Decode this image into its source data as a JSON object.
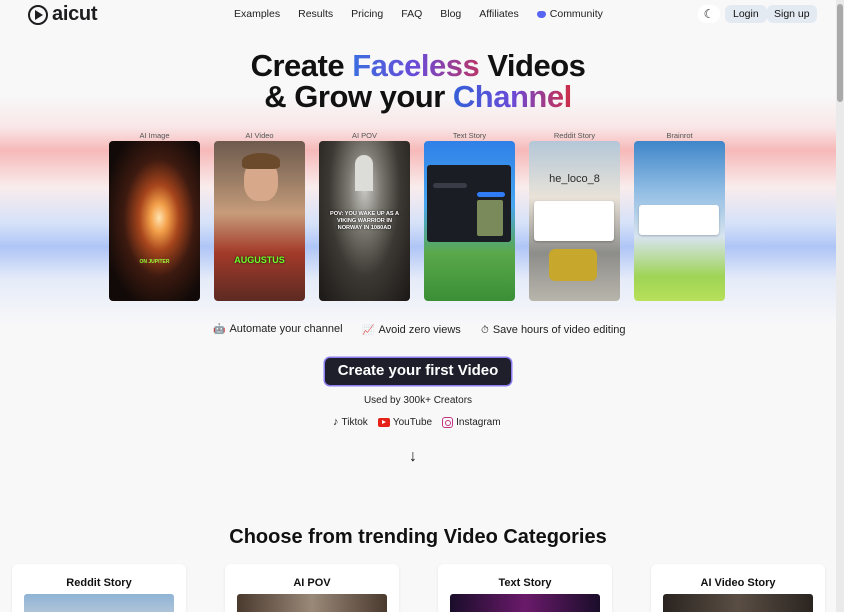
{
  "brand": {
    "name": "aicut"
  },
  "nav": {
    "links": [
      "Examples",
      "Results",
      "Pricing",
      "FAQ",
      "Blog",
      "Affiliates"
    ],
    "community": "Community",
    "login": "Login",
    "signup": "Sign up"
  },
  "hero": {
    "line1_a": "Create ",
    "line1_b": "Faceless",
    "line1_c": " Videos",
    "line2_a": "& Grow your ",
    "line2_b": "Channel"
  },
  "cards": [
    {
      "label": "AI Image",
      "overlay": "ON JUPITER"
    },
    {
      "label": "AI Video",
      "overlay": "AUGUSTUS"
    },
    {
      "label": "AI POV",
      "overlay": "POV: YOU WAKE UP AS A VIKING WARRIOR IN NORWAY IN 1080AD"
    },
    {
      "label": "Text Story",
      "overlay": ""
    },
    {
      "label": "Reddit Story",
      "overlay": "he_loco_8"
    },
    {
      "label": "Brainrot",
      "overlay": ""
    }
  ],
  "features": [
    {
      "icon": "robot-icon",
      "text": "Automate your channel"
    },
    {
      "icon": "chart-icon",
      "text": "Avoid zero views"
    },
    {
      "icon": "stopwatch-icon",
      "text": "Save hours of video editing"
    }
  ],
  "cta": {
    "label": "Create your first Video"
  },
  "used_by": "Used by 300k+ Creators",
  "platforms": [
    "Tiktok",
    "YouTube",
    "Instagram"
  ],
  "categories_title": "Choose from trending Video Categories",
  "categories": [
    "Reddit Story",
    "AI POV",
    "Text Story",
    "AI Video Story"
  ]
}
